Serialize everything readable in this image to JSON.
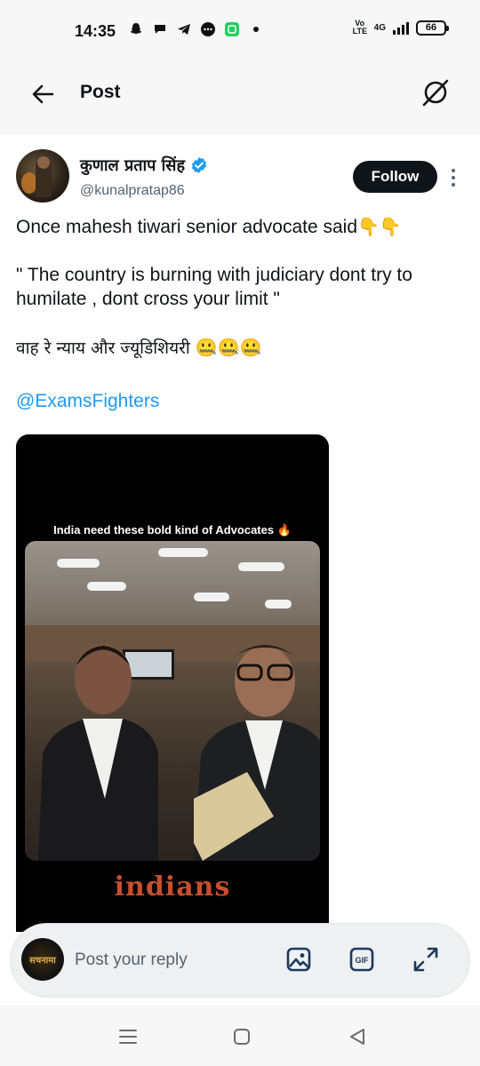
{
  "status_bar": {
    "time": "14:35",
    "volte": "Vo LTE",
    "network": "4G",
    "battery": "66"
  },
  "header": {
    "title": "Post"
  },
  "post": {
    "author": {
      "display_name": "कुणाल प्रताप सिंह",
      "handle": "@kunalpratap86",
      "verified": true
    },
    "follow_label": "Follow",
    "text": {
      "line1": "Once mahesh tiwari senior advocate said",
      "line1_emoji": "👇👇",
      "line2": "\" The country is burning with judiciary dont try to humilate , dont cross your limit \"",
      "line3": "वाह रे न्याय और ज्यूडिशियरी",
      "line3_emoji": "🤐🤐🤐",
      "mention": "@ExamsFighters"
    },
    "media": {
      "caption": "India need these bold kind of Advocates 🔥",
      "watermark": "indians"
    }
  },
  "reply": {
    "placeholder": "Post your reply",
    "avatar_text": "सचनामा"
  },
  "colors": {
    "accent": "#1d9bf0",
    "verified": "#1d9bf0",
    "text": "#0f1419",
    "secondary": "#536471"
  }
}
